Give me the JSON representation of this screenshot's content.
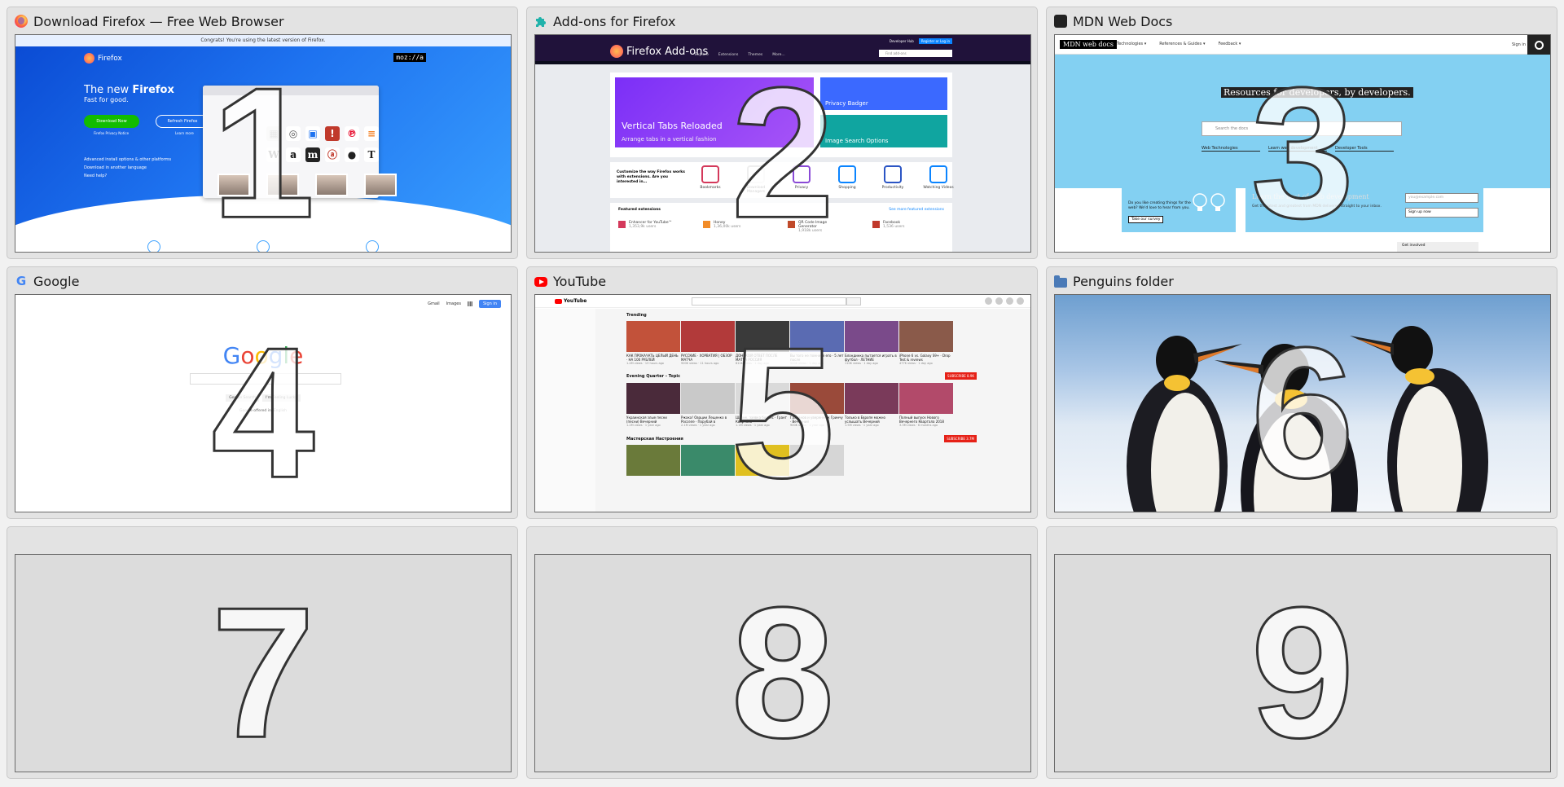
{
  "tiles": [
    {
      "number": "1",
      "title": "Download Firefox — Free Web Browser",
      "favicon": "firefox-icon"
    },
    {
      "number": "2",
      "title": "Add-ons for Firefox",
      "favicon": "puzzle-piece-icon"
    },
    {
      "number": "3",
      "title": "MDN Web Docs",
      "favicon": "mdn-dino-icon"
    },
    {
      "number": "4",
      "title": "Google",
      "favicon": "google-g-icon"
    },
    {
      "number": "5",
      "title": "YouTube",
      "favicon": "youtube-play-icon"
    },
    {
      "number": "6",
      "title": "Penguins folder",
      "favicon": "folder-icon"
    },
    {
      "number": "7",
      "title": ""
    },
    {
      "number": "8",
      "title": ""
    },
    {
      "number": "9",
      "title": ""
    }
  ],
  "firefox_page": {
    "notice": "Congrats! You're using the latest version of Firefox.",
    "logo_text": "Firefox",
    "mozilla": "moz://a",
    "headline_prefix": "The new",
    "headline_bold": "Firefox",
    "subheadline": "Fast for good.",
    "download_button": "Download Now",
    "refresh_button": "Refresh Firefox",
    "privacy_link": "Firefox Privacy Notice",
    "learn_more": "Learn more",
    "links": [
      "Advanced install options & other platforms",
      "Download in another language",
      "Need help?"
    ]
  },
  "amo_page": {
    "logo_text": "Firefox Add-ons",
    "nav": [
      "Explore",
      "Extensions",
      "Themes",
      "More..."
    ],
    "dev_hub": "Developer Hub",
    "register": "Register or Log in",
    "search_placeholder": "Find add-ons",
    "hero_main_title": "Vertical Tabs Reloaded",
    "hero_main_sub": "Arrange tabs in a vertical fashion",
    "hero_side_1": "Privacy Badger",
    "hero_side_2": "Image Search Options",
    "category_intro": "Customize the way Firefox works with extensions. Are you interested in…",
    "categories": [
      "Bookmarks",
      "Download Managers",
      "Privacy",
      "Shopping",
      "Productivity",
      "Watching Videos"
    ],
    "featured_heading": "Featured extensions",
    "featured_more": "See more featured extensions",
    "featured": [
      {
        "name": "Enhancer for YouTube™",
        "users": "1,353,9k users"
      },
      {
        "name": "Honey",
        "users": "1,36,00k users"
      },
      {
        "name": "QR Code Image Generator",
        "users": "1,918k users"
      },
      {
        "name": "Facebook",
        "users": "1,536 users"
      }
    ]
  },
  "mdn_page": {
    "logo_text": "MDN web docs",
    "nav": [
      "Technologies ▾",
      "References & Guides ▾",
      "Feedback ▾"
    ],
    "sign_in": "Sign in",
    "tagline": "Resources for developers, by developers.",
    "search_placeholder": "Search the docs",
    "links": [
      "Web Technologies",
      "Learn web development",
      "Developer Tools"
    ],
    "survey_text": "Do you like creating things for the web? We'd love to hear from you.",
    "survey_button": "Take our survey",
    "newsletter_title": "Learn the best of web development",
    "newsletter_sub": "Get the latest and greatest from MDN delivered straight to your inbox.",
    "email_placeholder": "you@example.com",
    "signup_button": "Sign up now",
    "get_involved": "Get involved"
  },
  "google_page": {
    "links": [
      "Gmail",
      "Images"
    ],
    "sign_in": "Sign in",
    "logo": "Google",
    "search_buttons": [
      "Google Search",
      "I'm Feeling Lucky"
    ],
    "language_line": "Google offered in: English"
  },
  "youtube_page": {
    "logo_text": "YouTube",
    "sections": [
      "Trending",
      "Evening Quarter - Topic",
      "Мастерская Настроения"
    ],
    "subscribe": [
      "SUBSCRIBE 8.9K",
      "SUBSCRIBE 3.7M"
    ],
    "rows": [
      [
        {
          "title": "КАК ПРОКАЧАТЬ ЦЕЛЫЙ ДЕНЬ · НА 100 РУБЛЕЙ",
          "meta": "1.4M views · 13 hours ago",
          "color": "#c2523a"
        },
        {
          "title": "РУССКИЕ · ХОРВАТИЯ | ОБЗОР МАТЧА",
          "meta": "900K views · 11 hours ago",
          "color": "#b23a3a"
        },
        {
          "title": "ДОНСКОЙ ОТВЕТ ПОСЛЕ МАТЧА РОССИЯ",
          "meta": "611K views · 1 day ago",
          "color": "#3a3a3a"
        },
        {
          "title": "Вы того не помните его · 5 лет после",
          "meta": "500K views · 1 day ago",
          "color": "#5a6bb2"
        },
        {
          "title": "Блондинка пытается играть в футбол · ЛЕТНИЕ",
          "meta": "110K views · 1 day ago",
          "color": "#7a4a8a"
        },
        {
          "title": "iPhone 6 vs. Galaxy S9+ · Drop Test & reviews",
          "meta": "477K views · 1 day ago",
          "color": "#8a5a4a"
        }
      ],
      [
        {
          "title": "Украинская злые песни (песни) Вечерний",
          "meta": "1.2M views · 1 year ago",
          "color": "#4a2a3a"
        },
        {
          "title": "Ржака! Овации Лещенко в Росселе · Порубай в",
          "meta": "2.1M views · 1 year ago",
          "color": "#c9c9c9"
        },
        {
          "title": "Шарик, заявка бизнес · Грант Квартала",
          "meta": "1.1M views · 1 year ago",
          "color": "#dadada"
        },
        {
          "title": "Газманов и уверенно к Гринчу · Вечерний",
          "meta": "900K views · 1 year ago",
          "color": "#9a4a3a"
        },
        {
          "title": "Только в Европе можно услышать Вечерний",
          "meta": "1.5M views · 1 year ago",
          "color": "#7a3a5a"
        },
        {
          "title": "Полный выпуск Нового Вечернего Квартала 2018",
          "meta": "3.3M views · 6 months ago",
          "color": "#b24a6a"
        }
      ],
      [
        {
          "title": "",
          "meta": "",
          "color": "#6a7a3a"
        },
        {
          "title": "",
          "meta": "",
          "color": "#3a8a6a"
        },
        {
          "title": "",
          "meta": "",
          "color": "#e0c020"
        },
        {
          "title": "",
          "meta": "",
          "color": "#d6d6d6"
        }
      ]
    ]
  }
}
